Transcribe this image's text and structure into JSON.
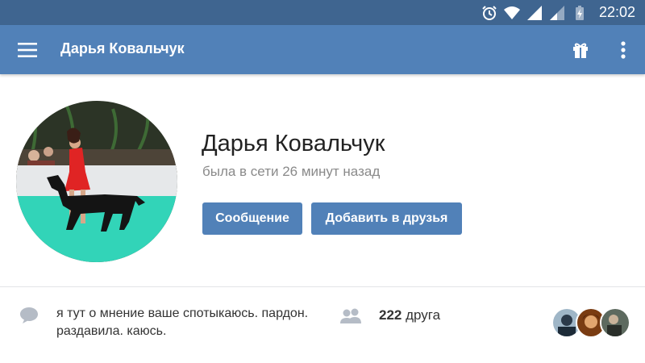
{
  "status_bar": {
    "time": "22:02",
    "icons": [
      "alarm-icon",
      "wifi-icon",
      "signal-icon",
      "signal-weak-icon",
      "battery-charging-icon"
    ],
    "background": "#3f6590"
  },
  "toolbar": {
    "title": "Дарья Ковальчук",
    "menu_icon": "hamburger-menu-icon",
    "gift_icon": "gift-icon",
    "more_icon": "more-vertical-icon",
    "background": "#5181b8"
  },
  "profile": {
    "name": "Дарья Ковальчук",
    "last_seen": "была в сети 26 минут назад",
    "avatar": "profile-photo"
  },
  "actions": {
    "message_label": "Сообщение",
    "add_friend_label": "Добавить в друзья",
    "accent": "#5181b8"
  },
  "status": {
    "icon": "speech-bubble-icon",
    "text": "я тут о мнение ваше спотыкаюсь. пардон. раздавила. каюсь."
  },
  "friends": {
    "icon": "friends-icon",
    "count": "222",
    "label": "друга",
    "avatars": [
      "friend-avatar-1",
      "friend-avatar-2",
      "friend-avatar-3"
    ]
  }
}
